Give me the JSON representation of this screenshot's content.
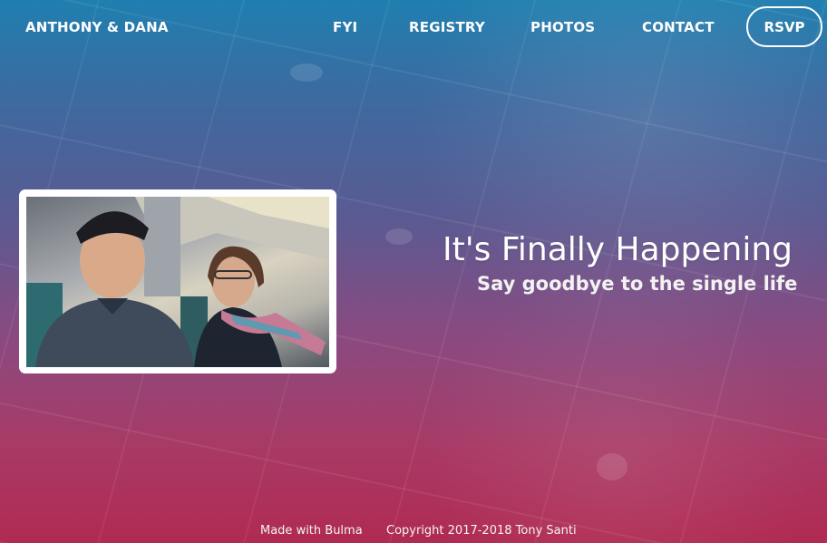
{
  "nav": {
    "brand": "ANTHONY & DANA",
    "links": [
      "FYI",
      "REGISTRY",
      "PHOTOS",
      "CONTACT"
    ],
    "rsvp": "RSVP"
  },
  "hero": {
    "title": "It's Finally Happening",
    "subtitle": "Say goodbye to the single life"
  },
  "footer": {
    "made_with": "Made with Bulma",
    "copyright": "Copyright 2017-2018 Tony Santi"
  },
  "colors": {
    "gradient_top": "#1f7fb0",
    "gradient_bottom": "#b02a52",
    "text": "#ffffff"
  }
}
